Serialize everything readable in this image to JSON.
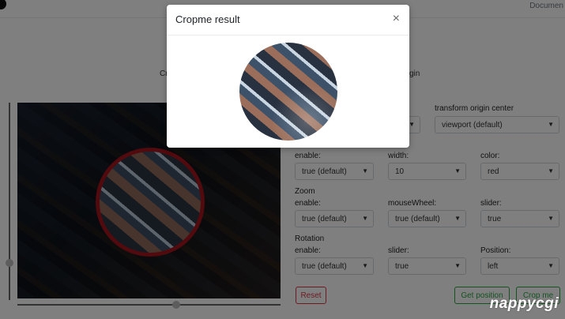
{
  "nav": {
    "docs_label": "Documen"
  },
  "page": {
    "heading_left": "Cr",
    "heading_right": "gin"
  },
  "settings": {
    "transform_origin_label": "transform origin center",
    "transform_origin_value": "viewport (default)",
    "border": {
      "enable_label": "enable:",
      "enable_value": "true (default)",
      "width_label": "width:",
      "width_value": "10",
      "color_label": "color:",
      "color_value": "red"
    },
    "zoom": {
      "title": "Zoom",
      "enable_label": "enable:",
      "enable_value": "true (default)",
      "mousewheel_label": "mouseWheel:",
      "mousewheel_value": "true (default)",
      "slider_label": "slider:",
      "slider_value": "true"
    },
    "rotation": {
      "title": "Rotation",
      "enable_label": "enable:",
      "enable_value": "true (default)",
      "slider_label": "slider:",
      "slider_value": "true",
      "position_label": "Position:",
      "position_value": "left"
    }
  },
  "buttons": {
    "reset": "Reset",
    "get_position": "Get position",
    "crop_me": "Crop me"
  },
  "modal": {
    "title": "Cropme result",
    "close": "×"
  },
  "watermark": "nappycgi",
  "colors": {
    "crop_border": "#a3141b",
    "reset": "#dc3545",
    "success": "#28a745"
  }
}
